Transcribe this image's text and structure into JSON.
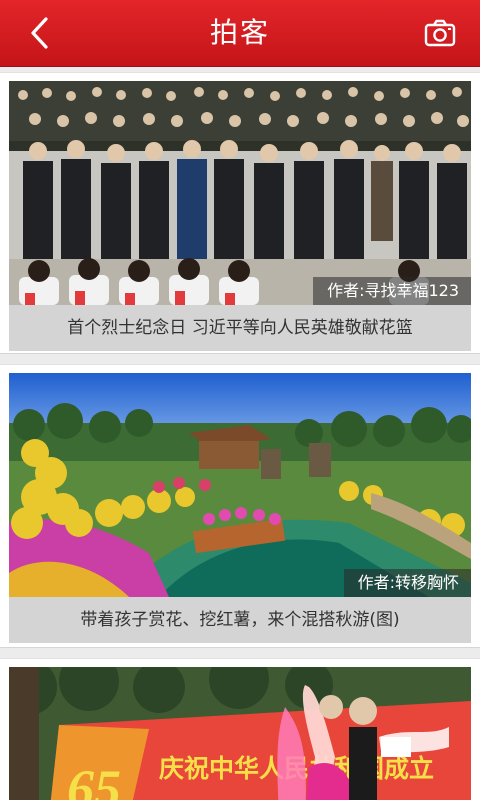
{
  "header": {
    "title": "拍客",
    "back_icon": "chevron-left-icon",
    "camera_icon": "camera-icon",
    "background_color": "#d81e22"
  },
  "feed": {
    "items": [
      {
        "author": "作者:寻找幸福123",
        "caption": "首个烈士纪念日 习近平等向人民英雄敬献花篮"
      },
      {
        "author": "作者:转移胸怀",
        "caption": "带着孩子赏花、挖红薯，来个混搭秋游(图)"
      },
      {
        "banner_text": "65",
        "banner_slogan": "庆祝中华人民共和国成立"
      }
    ]
  }
}
